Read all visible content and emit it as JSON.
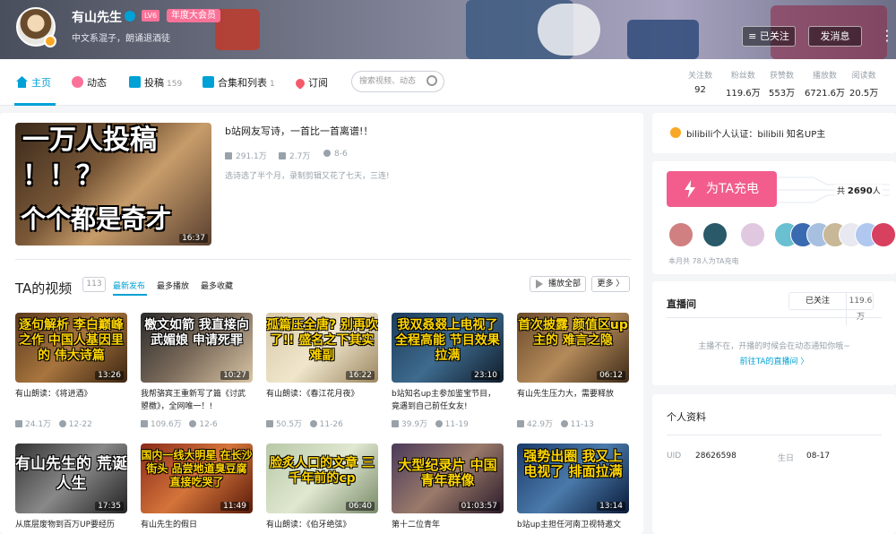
{
  "header": {
    "username": "有山先生",
    "level": "LV6",
    "vip": "年度大会员",
    "signature": "中文系混子，朗诵退酒徒",
    "follow_btn": "已关注",
    "message_btn": "发消息",
    "more_btn": "⋮"
  },
  "nav": {
    "items": [
      {
        "label": "主页",
        "icon": "home-icon",
        "count": ""
      },
      {
        "label": "动态",
        "icon": "dynamic-icon",
        "count": ""
      },
      {
        "label": "投稿",
        "icon": "upload-icon",
        "count": "159"
      },
      {
        "label": "合集和列表",
        "icon": "collection-icon",
        "count": "1"
      },
      {
        "label": "订阅",
        "icon": "heart-icon",
        "count": ""
      }
    ],
    "search_placeholder": "搜索视频、动态"
  },
  "stats": [
    {
      "label": "关注数",
      "value": "92"
    },
    {
      "label": "粉丝数",
      "value": "119.6万"
    },
    {
      "label": "获赞数",
      "value": "553万"
    },
    {
      "label": "播放数",
      "value": "6721.6万"
    },
    {
      "label": "阅读数",
      "value": "20.5万"
    }
  ],
  "featured": {
    "thumb_line1": "一万人投稿",
    "thumb_line2": "！！？",
    "thumb_line3": "个个都是奇才",
    "duration": "16:37",
    "title": "b站网友写诗，一首比一首离谱!！",
    "plays": "291.1万",
    "danmaku": "2.7万",
    "date": "8-6",
    "desc": "选诗选了半个月，录制剪辑又花了七天，三连!"
  },
  "videos_section": {
    "title": "TA的视频",
    "count": "113",
    "tabs": [
      "最新发布",
      "最多播放",
      "最多收藏"
    ],
    "play_all": "播放全部",
    "more": "更多"
  },
  "videos": [
    {
      "cap": "逐句解析 李白巅峰之作 中国人基因里的 伟大诗篇",
      "duration": "13:26",
      "title": "有山朗读：《将进酒》",
      "plays": "24.1万",
      "date": "12-22"
    },
    {
      "cap": "檄文如箭 我直接向武媚娘 申请死罪",
      "duration": "10:27",
      "title": "我帮骆宾王重新写了篇《讨武曌檄》，全网唯一！!",
      "plays": "109.6万",
      "date": "12-6"
    },
    {
      "cap": "孤篇压全唐? 别再吹了!! 盛名之下其实难副",
      "duration": "16:22",
      "title": "有山朗读：《春江花月夜》",
      "plays": "50.5万",
      "date": "11-26"
    },
    {
      "cap": "我双叒叕上电视了 全程高能 节目效果拉满",
      "duration": "23:10",
      "title": "b站知名up主参加鉴宝节目，竟遇到自己前任女友!",
      "plays": "39.9万",
      "date": "11-19"
    },
    {
      "cap": "首次披露 颜值区up主的 难言之隐",
      "duration": "06:12",
      "title": "有山先生压力大，需要释放",
      "plays": "42.9万",
      "date": "11-13"
    },
    {
      "cap": "有山先生的 荒诞人生",
      "duration": "17:35",
      "title": "从底层废物到百万UP要经历",
      "plays": "",
      "date": ""
    },
    {
      "cap": "国内一线大明星 在长沙街头 品尝地道臭豆腐 直接吃哭了",
      "duration": "11:49",
      "title": "有山先生的假日",
      "plays": "",
      "date": ""
    },
    {
      "cap": "脸炙人口的文章 三千年前的cp",
      "duration": "06:40",
      "title": "有山朗读：《伯牙绝弦》",
      "plays": "",
      "date": ""
    },
    {
      "cap": "大型纪录片 中国青年群像",
      "duration": "01:03:57",
      "title": "第十二位青年",
      "plays": "",
      "date": ""
    },
    {
      "cap": "强势出圈 我又上电视了 排面拉满",
      "duration": "13:14",
      "title": "b站up主担任河南卫视特邀文",
      "plays": "",
      "date": ""
    }
  ],
  "side": {
    "cert": "bilibili个人认证：bilibili 知名UP主",
    "charge_btn": "为TA充电",
    "charge_total_prefix": "共",
    "charge_total": "2690",
    "charge_total_suffix": "人",
    "charge_month": "本月共 78人为TA充电",
    "live_title": "直播间",
    "live_follow": "已关注",
    "live_count": "119.6万",
    "live_msg": "主播不在，开播的时候会在动态通知你哦~",
    "live_link": "前往TA的直播间 〉",
    "info_title": "个人资料",
    "uid_label": "UID",
    "uid": "28626598",
    "birthday_label": "生日",
    "birthday": "08-17"
  },
  "colors": {
    "accent": "#00a1d6",
    "pink": "#fb7299",
    "charge": "#f25d8e"
  }
}
